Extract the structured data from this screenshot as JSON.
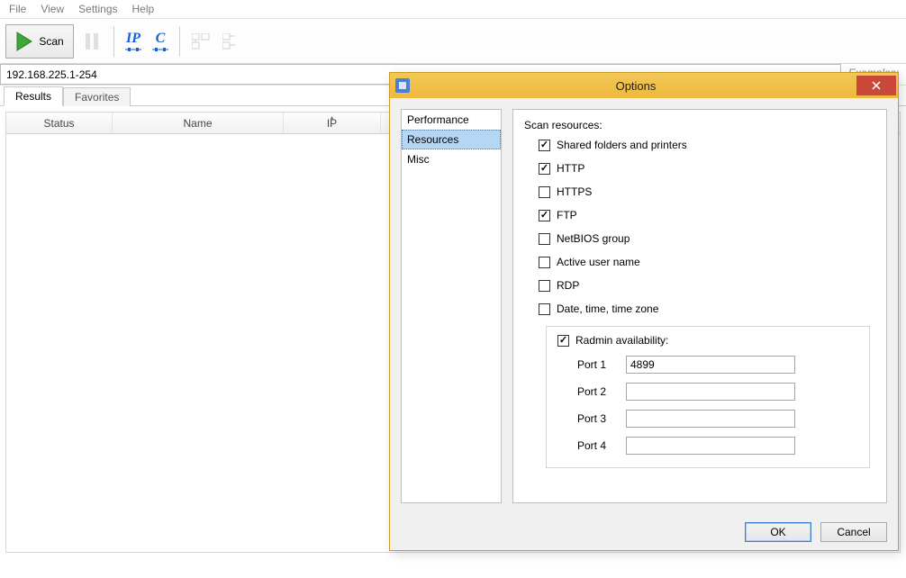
{
  "menubar": [
    "File",
    "View",
    "Settings",
    "Help"
  ],
  "toolbar": {
    "scan_label": "Scan"
  },
  "ipbar": {
    "value": "192.168.225.1-254",
    "examples_hint": "Examples"
  },
  "tabs": {
    "results": "Results",
    "favorites": "Favorites"
  },
  "grid": {
    "columns": {
      "status": "Status",
      "name": "Name",
      "ip": "IP"
    }
  },
  "dialog": {
    "title": "Options",
    "sidebar": {
      "performance": "Performance",
      "resources": "Resources",
      "misc": "Misc"
    },
    "main": {
      "section_title": "Scan resources:",
      "shared": {
        "label": "Shared folders and printers",
        "checked": true
      },
      "http": {
        "label": "HTTP",
        "checked": true
      },
      "https": {
        "label": "HTTPS",
        "checked": false
      },
      "ftp": {
        "label": "FTP",
        "checked": true
      },
      "netbios": {
        "label": "NetBIOS group",
        "checked": false
      },
      "user": {
        "label": "Active user name",
        "checked": false
      },
      "rdp": {
        "label": "RDP",
        "checked": false
      },
      "datetime": {
        "label": "Date, time, time zone",
        "checked": false
      },
      "radmin": {
        "label": "Radmin availability:",
        "checked": true,
        "ports": {
          "p1": {
            "label": "Port 1",
            "value": "4899"
          },
          "p2": {
            "label": "Port 2",
            "value": ""
          },
          "p3": {
            "label": "Port 3",
            "value": ""
          },
          "p4": {
            "label": "Port 4",
            "value": ""
          }
        }
      }
    },
    "buttons": {
      "ok": "OK",
      "cancel": "Cancel"
    }
  }
}
